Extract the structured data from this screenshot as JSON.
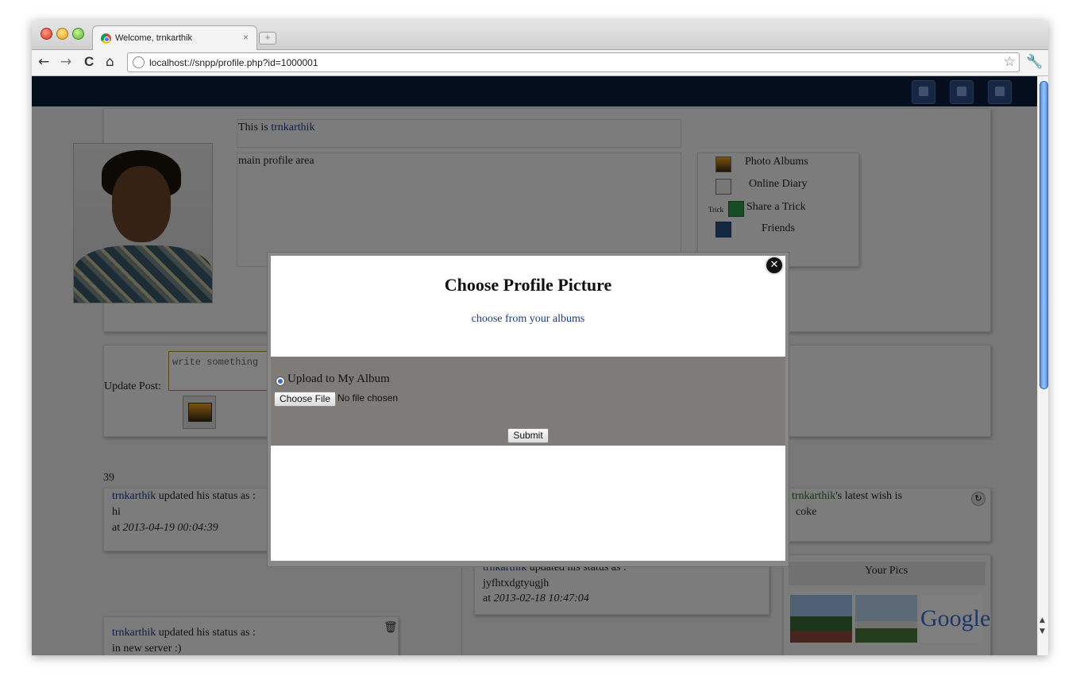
{
  "browser": {
    "tab_title": "Welcome, trnkarthik",
    "tab_close": "×",
    "new_tab": "+",
    "url": "localhost://snpp/profile.php?id=1000001",
    "back": "←",
    "forward": "→",
    "reload": "C",
    "home": "⌂",
    "bookmark": "☆",
    "wrench": "🔧"
  },
  "page": {
    "title_prefix": "This is ",
    "username": "trnkarthik",
    "main_area": "main profile area",
    "menu": [
      {
        "label": "Photo Albums",
        "icon": "photo-icon"
      },
      {
        "label": "Online Diary",
        "icon": "diary-icon"
      },
      {
        "label": "Share a Trick",
        "icon": "share-icon",
        "prefix": "Trick"
      },
      {
        "label": "Friends",
        "icon": "friends-icon"
      }
    ],
    "update_post_label": "Update Post:",
    "post_placeholder": "write something",
    "post_count": "39",
    "statuses_left": [
      {
        "user": "trnkarthik",
        "text": " updated his status as :",
        "status": "hi",
        "at": "at ",
        "time": "2013-04-19 00:04:39"
      },
      {
        "user": "trnkarthik",
        "text": " updated his status as :",
        "status": "in new server :)"
      }
    ],
    "status_middle": {
      "user": "trnkarthik",
      "text": " updated his status as :",
      "status": "jyfhtxdgtyugjh",
      "at": "at ",
      "time": "2013-02-18 10:47:04"
    },
    "wish": {
      "user": "trnkarthik",
      "text": "'s latest wish is",
      "value": "coke"
    },
    "your_pics": "Your Pics",
    "google_logo": "Google"
  },
  "modal": {
    "title": "Choose Profile Picture",
    "albums_link": "choose from your albums",
    "close": "✕",
    "radio_label": "Upload to My Album",
    "choose_file": "Choose File",
    "no_file": "No file chosen",
    "submit": "Submit"
  }
}
